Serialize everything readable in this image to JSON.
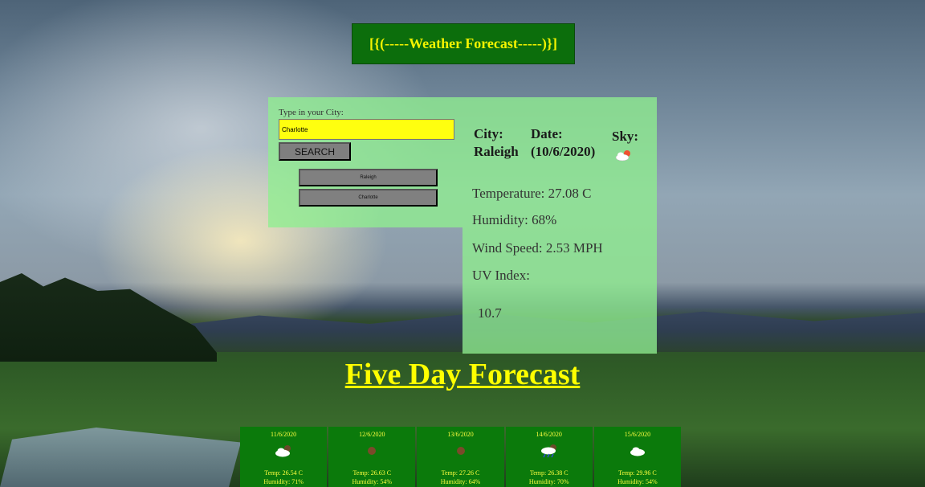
{
  "header": {
    "title": "[{(-----Weather Forecast-----)}]"
  },
  "search": {
    "label": "Type in your City:",
    "value": "Charlotte",
    "button_label": "SEARCH",
    "history": [
      "Raleigh",
      "Charlotte"
    ]
  },
  "current": {
    "city_label": "City:",
    "city": "Raleigh",
    "date_label": "Date:",
    "date": "(10/6/2020)",
    "sky_label": "Sky:",
    "sky_icon": "partly-cloudy-day-icon",
    "temperature": "Temperature: 27.08 C",
    "humidity": "Humidity: 68%",
    "wind": "Wind Speed: 2.53 MPH",
    "uv_label": "UV Index:",
    "uv_value": "10.7"
  },
  "forecast": {
    "title": "Five Day Forecast",
    "days": [
      {
        "date": "11/6/2020",
        "icon": "cloudy-icon",
        "temp": "Temp: 26.54 C",
        "humidity": "Humidity: 71%"
      },
      {
        "date": "12/6/2020",
        "icon": "clear-night-icon",
        "temp": "Temp: 26.63 C",
        "humidity": "Humidity: 54%"
      },
      {
        "date": "13/6/2020",
        "icon": "clear-night-icon",
        "temp": "Temp: 27.26 C",
        "humidity": "Humidity: 64%"
      },
      {
        "date": "14/6/2020",
        "icon": "rain-icon",
        "temp": "Temp: 26.38 C",
        "humidity": "Humidity: 70%"
      },
      {
        "date": "15/6/2020",
        "icon": "cloud-icon",
        "temp": "Temp: 29.96 C",
        "humidity": "Humidity: 54%"
      }
    ]
  },
  "colors": {
    "title_bg": "#0c6e0c",
    "title_text": "#f3f300",
    "panel": "#90ee90",
    "input": "#ffff0f",
    "forecast_bg": "#0b7a0b"
  }
}
